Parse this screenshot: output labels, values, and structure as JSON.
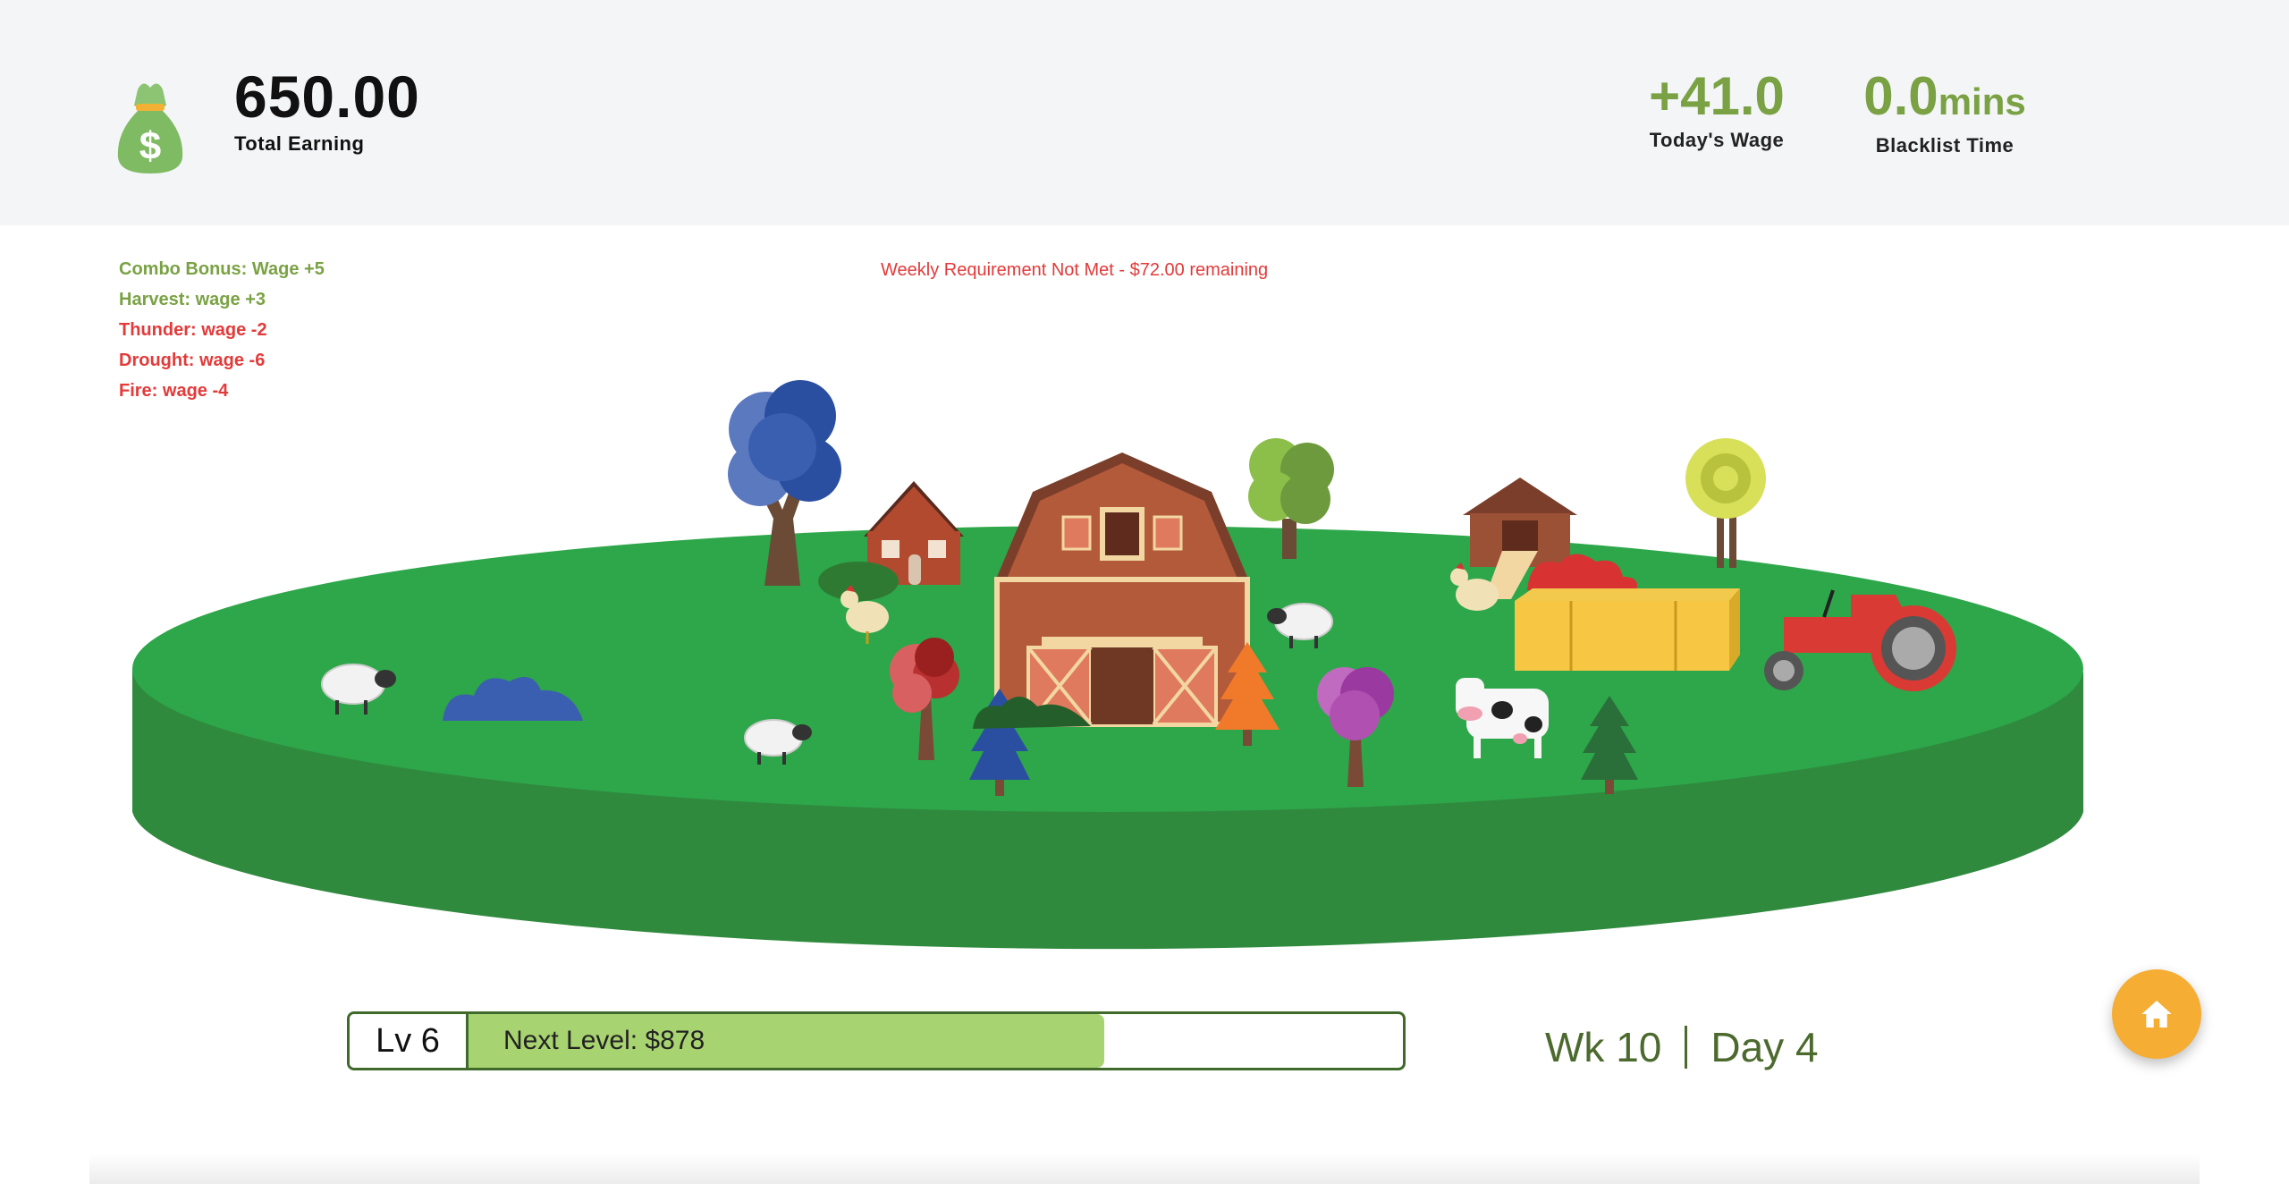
{
  "header": {
    "total_earning_value": "650.00",
    "total_earning_label": "Total Earning",
    "money_icon": "money-bag-icon",
    "todays_wage_value": "+41.0",
    "todays_wage_label": "Today's Wage",
    "blacklist_value": "0.0",
    "blacklist_unit": "mins",
    "blacklist_label": "Blacklist Time",
    "accent_green": "#7aa244"
  },
  "events": [
    {
      "text": "Combo Bonus: Wage +5",
      "type": "positive"
    },
    {
      "text": "Harvest: wage +3",
      "type": "positive"
    },
    {
      "text": "Thunder: wage -2",
      "type": "negative"
    },
    {
      "text": "Drought: wage -6",
      "type": "negative"
    },
    {
      "text": "Fire: wage -4",
      "type": "negative"
    }
  ],
  "requirement_message": "Weekly Requirement Not Met - $72.00 remaining",
  "farm": {
    "elements": [
      "barn",
      "house",
      "chicken-coop",
      "tractor",
      "hay-bales",
      "cow",
      "sheep",
      "chickens",
      "trees",
      "bushes"
    ]
  },
  "level": {
    "label": "Lv 6",
    "next_label": "Next Level: $878",
    "progress": 0.68
  },
  "calendar": {
    "week": "Wk 10",
    "day": "Day 4"
  },
  "home_button": {
    "icon": "home-icon",
    "color": "#f5ad33"
  },
  "colors": {
    "positive": "#7aa244",
    "negative": "#e33a3a",
    "field_top": "#2ea64a",
    "field_side": "#2f8a3e"
  }
}
